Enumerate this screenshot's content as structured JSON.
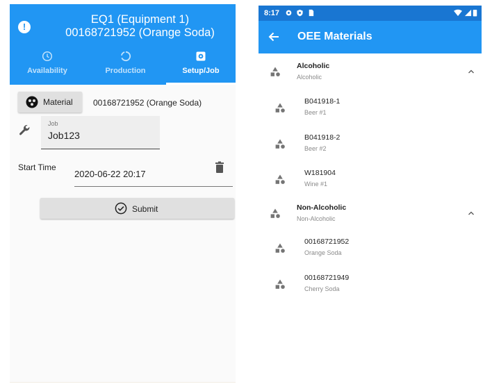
{
  "left": {
    "alert_icon": "alert-circle-icon",
    "equipment_title": "EQ1 (Equipment 1)",
    "equipment_subtitle": "00168721952 (Orange Soda)",
    "tabs": [
      {
        "label": "Availability",
        "icon": "clock-icon",
        "active": false
      },
      {
        "label": "Production",
        "icon": "progress-circle-icon",
        "active": false
      },
      {
        "label": "Setup/Job",
        "icon": "settings-box-icon",
        "active": true
      }
    ],
    "material_button": "Material",
    "material_value": "00168721952 (Orange Soda)",
    "job_caption": "Job",
    "job_value": "Job123",
    "start_time_label": "Start Time",
    "start_time_value": "2020-06-22 20:17",
    "submit_label": "Submit"
  },
  "right": {
    "status_time": "8:17",
    "title": "OEE Materials",
    "groups": [
      {
        "name": "Alcoholic",
        "description": "Alcoholic",
        "items": [
          {
            "name": "B041918-1",
            "description": "Beer #1"
          },
          {
            "name": "B041918-2",
            "description": "Beer #2"
          },
          {
            "name": "W181904",
            "description": "Wine #1"
          }
        ]
      },
      {
        "name": "Non-Alcoholic",
        "description": "Non-Alcoholic",
        "items": [
          {
            "name": "00168721952",
            "description": "Orange Soda"
          },
          {
            "name": "00168721949",
            "description": "Cherry Soda"
          }
        ]
      }
    ]
  },
  "colors": {
    "primary": "#2196f3",
    "status_bar": "#1976d2",
    "button": "#e0e0e0"
  }
}
